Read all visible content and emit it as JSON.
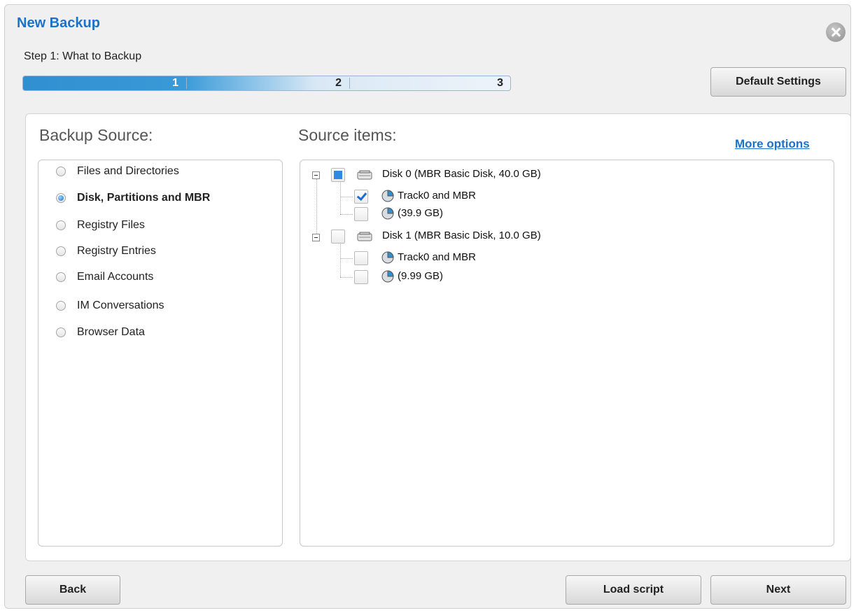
{
  "dialog": {
    "title": "New Backup",
    "step_text": "Step 1: What to Backup",
    "progress": {
      "steps": [
        "1",
        "2",
        "3"
      ],
      "current_step": 1
    },
    "default_settings_label": "Default Settings"
  },
  "backup_source": {
    "title": "Backup Source:",
    "options": [
      {
        "label": "Files and Directories",
        "selected": false
      },
      {
        "label": "Disk, Partitions and MBR",
        "selected": true
      },
      {
        "label": "Registry Files",
        "selected": false
      },
      {
        "label": "Registry Entries",
        "selected": false
      },
      {
        "label": "Email Accounts",
        "selected": false
      },
      {
        "label": "IM Conversations",
        "selected": false
      },
      {
        "label": "Browser Data",
        "selected": false
      }
    ]
  },
  "source_items": {
    "title": "Source items:",
    "more_options_label": "More options",
    "tree": [
      {
        "label": "Disk 0 (MBR Basic Disk, 40.0 GB)",
        "state": "partial",
        "children": [
          {
            "label": "Track0 and MBR",
            "checked": true
          },
          {
            "label": "(39.9 GB)",
            "checked": false
          }
        ]
      },
      {
        "label": "Disk 1 (MBR Basic Disk, 10.0 GB)",
        "state": "unchecked",
        "children": [
          {
            "label": "Track0 and MBR",
            "checked": false
          },
          {
            "label": "(9.99 GB)",
            "checked": false
          }
        ]
      }
    ]
  },
  "footer": {
    "back_label": "Back",
    "load_script_label": "Load script",
    "next_label": "Next"
  }
}
